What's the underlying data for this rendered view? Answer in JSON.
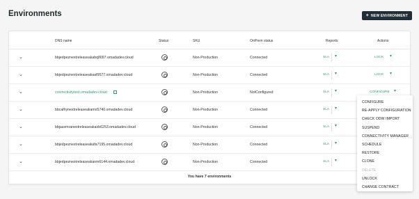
{
  "header": {
    "title": "Environments",
    "new_button_label": "NEW ENVIRONMENT"
  },
  "table": {
    "columns": [
      "DNS name",
      "Status",
      "SKU",
      "OnPrem status",
      "Reports",
      "Actions"
    ],
    "rows": [
      {
        "dns": "bbjedpeznextreleaseakabq8097.omadadev.cloud",
        "sku": "Non-Production",
        "onprem": "Connected",
        "report": "SLA",
        "action": "LOCK"
      },
      {
        "dns": "bbjedpeznextreleaseakaaf9577.omadadev.cloud",
        "sku": "Non-Production",
        "onprem": "Connected",
        "report": "SLA",
        "action": "LOCK"
      },
      {
        "dns": "connectivitytest.omadadev.cloud",
        "sku": "Non-Production",
        "onprem": "NotConfigured",
        "report": "SLA",
        "action": "CONFIGURE"
      },
      {
        "dns": "bbcalfrynextreleaseakamo5740.omadadev.cloud",
        "sku": "Non-Production",
        "onprem": "Connected",
        "report": "SLA",
        "action": ""
      },
      {
        "dns": "bbjaavmranextreleaseakaob6253.omadadev.cloud",
        "sku": "Non-Production",
        "onprem": "Connected",
        "report": "SLA",
        "action": ""
      },
      {
        "dns": "bbjedpeznextreleaseakafa7195.omadadev.cloud",
        "sku": "Non-Production",
        "onprem": "Connected",
        "report": "SLA",
        "action": ""
      },
      {
        "dns": "bbjedpeznextreleaseakanm6144.omadadev.cloud",
        "sku": "Non-Production",
        "onprem": "Connected",
        "report": "SLA",
        "action": ""
      }
    ],
    "footer": "You have 7 environments"
  },
  "menu": {
    "items": [
      {
        "label": "CONFIGURE",
        "disabled": false
      },
      {
        "label": "RE-APPLY CONFIGURATION",
        "disabled": false
      },
      {
        "label": "CHECK ODW IMPORT",
        "disabled": false
      },
      {
        "label": "SUSPEND",
        "disabled": false
      },
      {
        "label": "CONNECTIVITY MANAGER",
        "disabled": false
      },
      {
        "label": "SCHEDULE",
        "disabled": false
      },
      {
        "label": "RESTORE",
        "disabled": false
      },
      {
        "label": "CLONE",
        "disabled": false
      },
      {
        "label": "DELETE",
        "disabled": true
      },
      {
        "label": "UNLOCK",
        "disabled": false
      },
      {
        "label": "CHANGE CONTRACT",
        "disabled": false
      }
    ]
  },
  "icons": {
    "expand": "chevron-down-icon",
    "status": "status-icon",
    "external": "external-link-icon"
  },
  "colors": {
    "accent": "#2c9d7a",
    "button_bg": "#1f2f35"
  }
}
